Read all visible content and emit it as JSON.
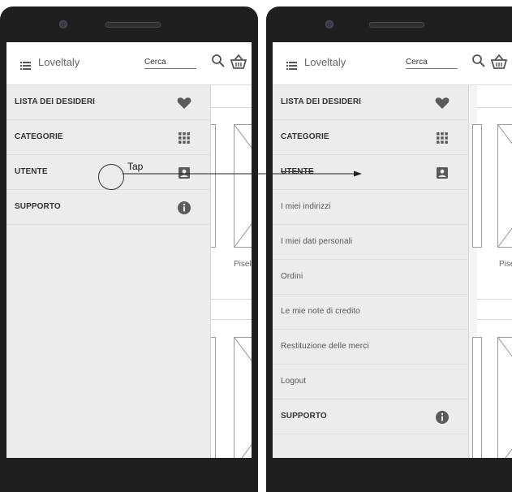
{
  "app": {
    "brand": "Loveltaly",
    "search_value": "Cerca"
  },
  "drawer_left": [
    {
      "label": "LISTA DEI DESIDERI",
      "icon": "heart-icon"
    },
    {
      "label": "CATEGORIE",
      "icon": "grid-icon"
    },
    {
      "label": "UTENTE",
      "icon": "user-card-icon"
    },
    {
      "label": "SUPPORTO",
      "icon": "info-icon"
    }
  ],
  "drawer_right": {
    "wishlist": "LISTA DEI DESIDERI",
    "categories": "CATEGORIE",
    "user": "UTENTE",
    "sub_items": [
      "I miei indirizzi",
      "I miei dati personali",
      "Ordini",
      "Le mie note di credito",
      "Restituzione delle merci",
      "Logout"
    ],
    "support": "SUPPORTO"
  },
  "annotation": {
    "tap_label": "Tap"
  },
  "content": {
    "product_label_cut": "Pisel"
  },
  "colors": {
    "phone_frame": "#1f1f1f",
    "drawer_bg": "#ececec",
    "icon_gray": "#5a5a5a"
  }
}
